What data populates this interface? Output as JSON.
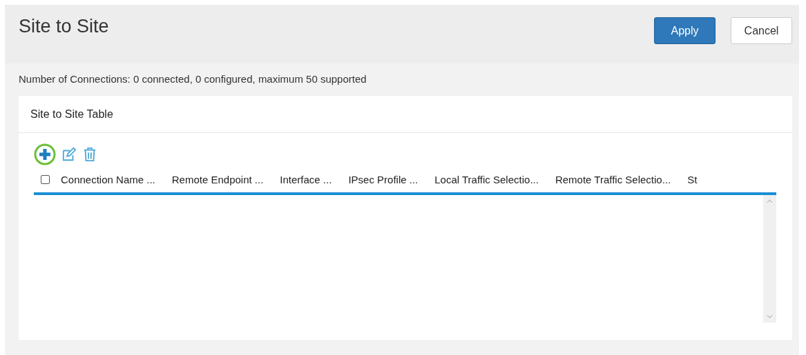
{
  "page": {
    "title": "Site to Site"
  },
  "buttons": [
    {
      "label": "Apply",
      "kind": "primary"
    },
    {
      "label": "Cancel",
      "kind": "secondary"
    }
  ],
  "summary": "Number of Connections: 0 connected, 0 configured, maximum 50 supported",
  "table": {
    "title": "Site to Site Table",
    "select_all": {
      "checked": false
    },
    "columns": [
      "Connection Name ...",
      "Remote Endpoint ...",
      "Interface ...",
      "IPsec Profile ...",
      "Local Traffic Selectio...",
      "Remote Traffic Selectio...",
      "St"
    ]
  }
}
